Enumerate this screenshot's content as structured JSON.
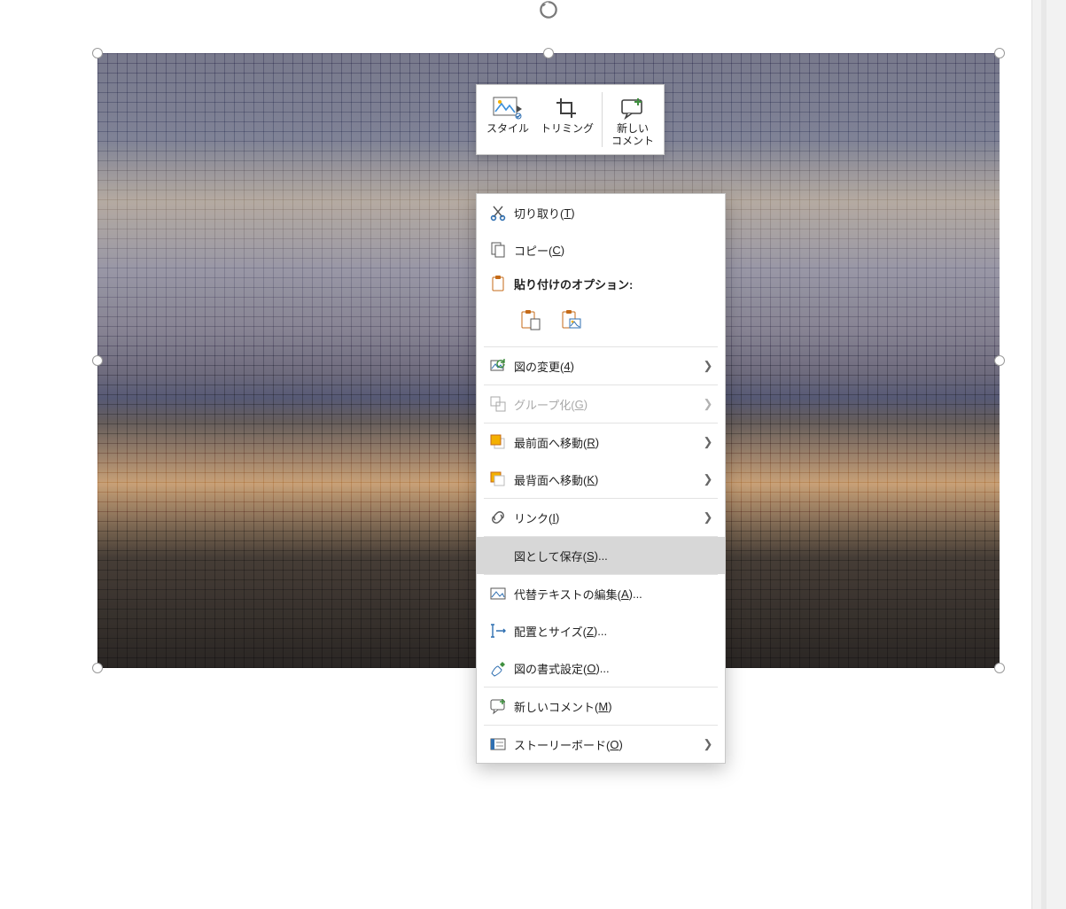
{
  "mini_toolbar": {
    "style_label": "スタイル",
    "crop_label": "トリミング",
    "new_comment_label": "新しい\nコメント"
  },
  "context_menu": {
    "cut": {
      "pre": "切り取り(",
      "mn": "T",
      "post": ")"
    },
    "copy": {
      "pre": "コピー(",
      "mn": "C",
      "post": ")"
    },
    "paste_header": {
      "pre": "貼り付けのオプション:",
      "mn": "",
      "post": ""
    },
    "change_picture": {
      "pre": "図の変更(",
      "mn": "4",
      "post": ")"
    },
    "group": {
      "pre": "グループ化(",
      "mn": "G",
      "post": ")"
    },
    "bring_front": {
      "pre": "最前面へ移動(",
      "mn": "R",
      "post": ")"
    },
    "send_back": {
      "pre": "最背面へ移動(",
      "mn": "K",
      "post": ")"
    },
    "link": {
      "pre": "リンク(",
      "mn": "I",
      "post": ")"
    },
    "save_as_picture": {
      "pre": "図として保存(",
      "mn": "S",
      "post": ")..."
    },
    "edit_alt_text": {
      "pre": "代替テキストの編集(",
      "mn": "A",
      "post": ")..."
    },
    "size_position": {
      "pre": "配置とサイズ(",
      "mn": "Z",
      "post": ")..."
    },
    "format_picture": {
      "pre": "図の書式設定(",
      "mn": "O",
      "post": ")..."
    },
    "new_comment": {
      "pre": "新しいコメント(",
      "mn": "M",
      "post": ")"
    },
    "storyboard": {
      "pre": "ストーリーボード(",
      "mn": "O",
      "post": ")"
    }
  }
}
